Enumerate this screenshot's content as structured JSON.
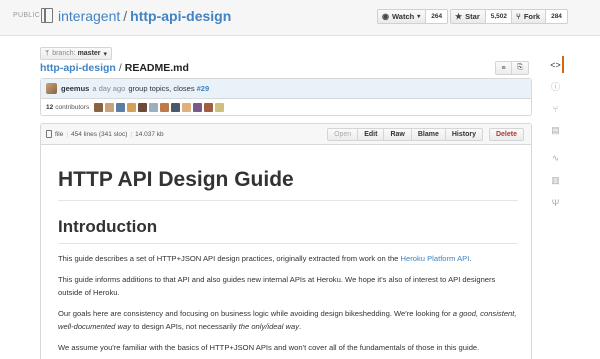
{
  "repo": {
    "visibility": "PUBLIC",
    "owner": "interagent",
    "separator": "/",
    "name": "http-api-design",
    "book_icon": "repo-book-icon"
  },
  "actions": {
    "watch": {
      "label": "Watch",
      "count": "264",
      "icon": "eye-icon"
    },
    "star": {
      "label": "Star",
      "count": "5,502",
      "icon": "star-icon"
    },
    "fork": {
      "label": "Fork",
      "count": "284",
      "icon": "fork-icon"
    }
  },
  "sidebar": {
    "items": [
      {
        "name": "code",
        "glyph": "<>",
        "active": true
      },
      {
        "name": "issues",
        "glyph": "ⓘ"
      },
      {
        "name": "pull-requests",
        "glyph": "⑂"
      },
      {
        "name": "wiki",
        "glyph": "▤"
      },
      {
        "name": "pulse",
        "glyph": "∿"
      },
      {
        "name": "graphs",
        "glyph": "▥"
      },
      {
        "name": "network",
        "glyph": "Ψ"
      }
    ],
    "active_color": "#d26911"
  },
  "branch": {
    "label": "branch:",
    "value": "master",
    "caret": "▾",
    "icon_glyph": "ᛘ"
  },
  "breadcrumb": {
    "root": "http-api-design",
    "separator": "/",
    "file": "README.md"
  },
  "view_buttons": [
    "≡",
    "⎘"
  ],
  "commit": {
    "author": "geemus",
    "time": "a day ago",
    "message": "group topics, closes",
    "issue_ref": "#29",
    "contributors_count": "12",
    "contributors_label": "contributors",
    "avatar_colors": [
      "#8a6440",
      "#c9a27c",
      "#5b7fa3",
      "#d4a05a",
      "#6b4a3a",
      "#9ab0c0",
      "#c07a4a",
      "#4a5a6a",
      "#e0b080",
      "#7a5a8a",
      "#a06040",
      "#d0c080"
    ]
  },
  "file": {
    "type_label": "file",
    "lines": "454 lines (341 sloc)",
    "size": "14.037 kb",
    "actions": [
      "Open",
      "Edit",
      "Raw",
      "Blame",
      "History"
    ],
    "delete_label": "Delete",
    "delete_color": "#b33630"
  },
  "content": {
    "h1": "HTTP API Design Guide",
    "h2": "Introduction",
    "p1_before_link": "This guide describes a set of HTTP+JSON API design practices, originally extracted from work on the ",
    "p1_link": "Heroku Platform API",
    "p1_after_link": ".",
    "p2": "This guide informs additions to that API and also guides new internal APIs at Heroku. We hope it's also of interest to API designers outside of Heroku.",
    "p3_start": "Our goals here are consistency and focusing on business logic while avoiding design bikeshedding. We're looking for ",
    "p3_em1": "a good, consistent, well-documented way",
    "p3_mid": " to design APIs, not necessarily ",
    "p3_em2": "the only/ideal way",
    "p3_end": ".",
    "p4": "We assume you're familiar with the basics of HTTP+JSON APIs and won't cover all of the fundamentals of those in this guide.",
    "link_color": "#4183c4"
  }
}
